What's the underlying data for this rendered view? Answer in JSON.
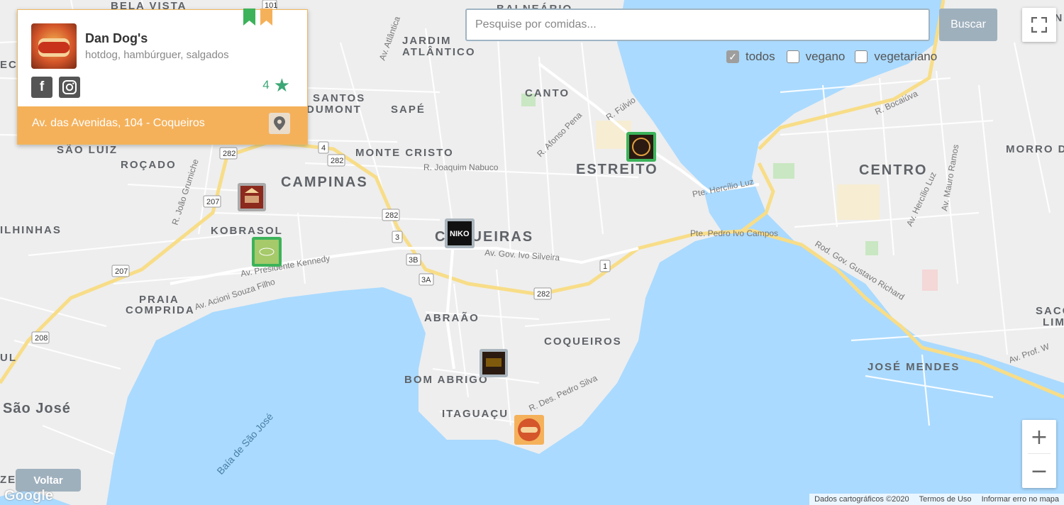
{
  "card": {
    "title": "Dan Dog's",
    "subtitle": "hotdog, hambúrguer, salgados",
    "rating": "4",
    "address": "Av. das Avenidas, 104 - Coqueiros",
    "icons": [
      "facebook-icon",
      "instagram-icon",
      "star-icon",
      "map-pin-icon"
    ]
  },
  "search": {
    "placeholder": "Pesquise por comidas...",
    "button": "Buscar"
  },
  "filters": [
    {
      "label": "todos",
      "checked": true
    },
    {
      "label": "vegano",
      "checked": false
    },
    {
      "label": "vegetariano",
      "checked": false
    }
  ],
  "controls": {
    "voltar": "Voltar",
    "zoom_in": "+",
    "zoom_out": "−"
  },
  "attribution": [
    "Dados cartográficos ©2020",
    "Termos de Uso",
    "Informar erro no mapa"
  ],
  "google_logo": "Google",
  "map_labels": {
    "neighborhoods": [
      "BELA VISTA",
      "JARDIM ATLÂNTICO",
      "SANTOS DUMONT",
      "SAPÉ",
      "CANTO",
      "ESTREITO",
      "CENTRO",
      "MORRO DA",
      "SÃO LUIZ",
      "ROÇADO",
      "CAMPINAS",
      "MONTE CRISTO",
      "KOBRASOL",
      "ILHINHAS",
      "COQUEIROS",
      "PRAIA COMPRIDA",
      "ABRAÃO",
      "BOM ABRIGO",
      "ITAGUAÇU",
      "JOSÉ MENDES",
      "SACO LIM",
      "São José",
      "ZE",
      "ECA",
      "UL"
    ],
    "streets": [
      "Av. Atlântica",
      "R. Fúlvio",
      "R. Bocaiúva",
      "R. Afonso Pena",
      "R. Joaquim Nabuco",
      "Pte. Hercílio Luz",
      "Pte. Pedro Ivo Campos",
      "Av. Gov. Ivo Silveira",
      "Av. Presidente Kennedy",
      "Av. Acioni Souza Filho",
      "R. João Grumiche",
      "Rod. Gov. Gustavo Richard",
      "R. Des. Pedro Silva",
      "Av. Hercílio Luz",
      "Av. Mauro Ramos",
      "Av. Prof. W",
      "BALNEÁRIO",
      "RONCA"
    ],
    "water": [
      "Baía de São José"
    ],
    "route_shields": [
      "101",
      "282",
      "282",
      "282",
      "282",
      "207",
      "207",
      "208",
      "4",
      "3",
      "3B",
      "3A",
      "1"
    ]
  },
  "markers": [
    "pizza-marker",
    "green-marker",
    "niko-marker",
    "shazam-marker",
    "deck-house-marker",
    "dan-dogs-marker"
  ],
  "colors": {
    "water": "#aadaff",
    "land": "#eeeeee",
    "card_accent": "#f5b15a",
    "rating": "#3ca776",
    "button": "#9fb0bd"
  }
}
